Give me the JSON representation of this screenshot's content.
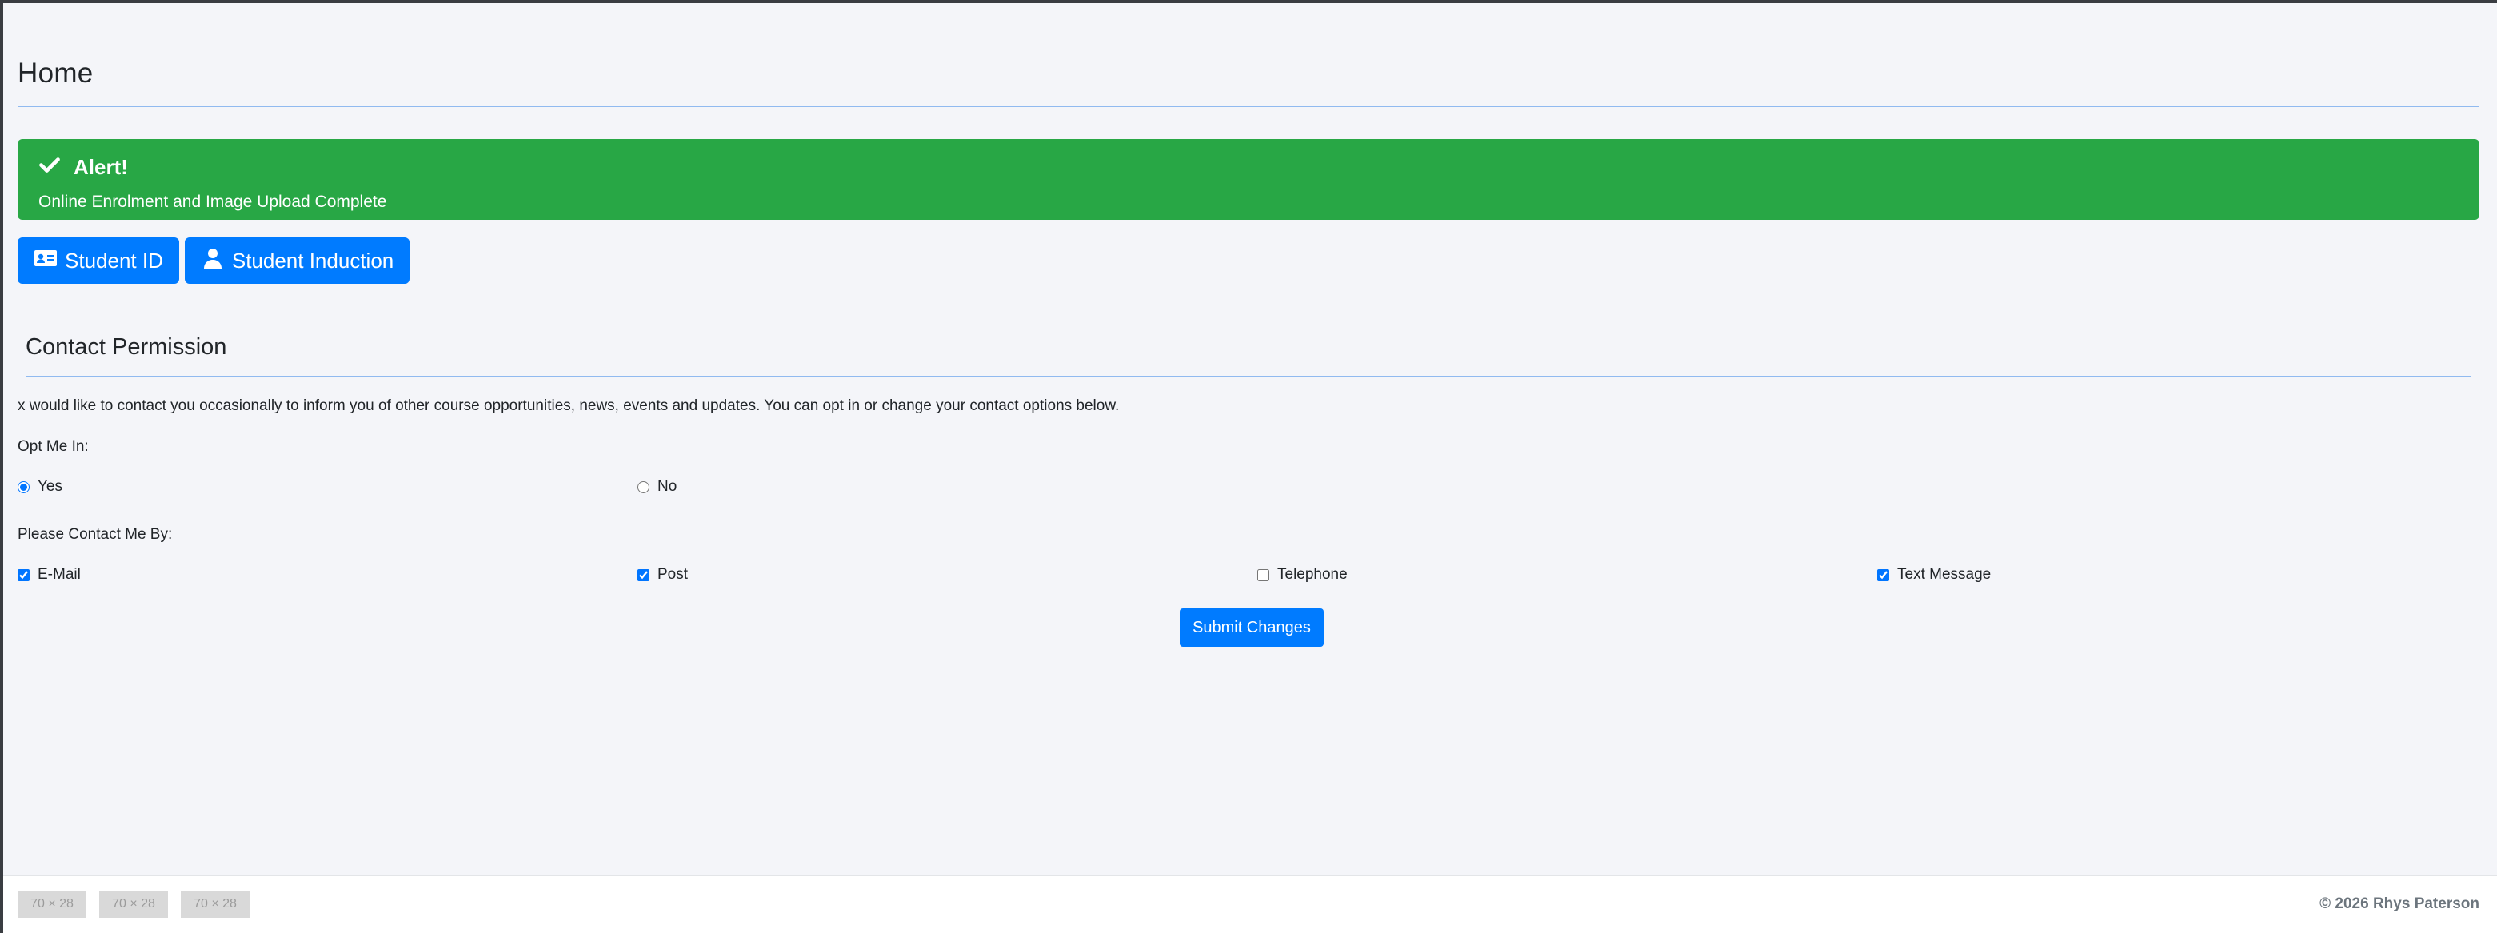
{
  "page": {
    "title": "Home"
  },
  "alert": {
    "heading": "Alert!",
    "message": "Online Enrolment and Image Upload Complete",
    "icon": "check-icon",
    "color": "#28a745"
  },
  "actions": [
    {
      "label": "Student ID",
      "icon": "id-card-icon"
    },
    {
      "label": "Student Induction",
      "icon": "user-icon"
    }
  ],
  "contact": {
    "title": "Contact Permission",
    "intro": "x would like to contact you occasionally to inform you of other course opportunities, news, events and updates. You can opt in or change your contact options below.",
    "opt_in_label": "Opt Me In:",
    "opt_in": {
      "yes": "Yes",
      "no": "No",
      "selected": "Yes"
    },
    "contact_by_label": "Please Contact Me By:",
    "methods": [
      {
        "label": "E-Mail",
        "checked": true
      },
      {
        "label": "Post",
        "checked": true
      },
      {
        "label": "Telephone",
        "checked": false
      },
      {
        "label": "Text Message",
        "checked": true
      }
    ],
    "submit_label": "Submit Changes"
  },
  "footer": {
    "placeholders": [
      "70 × 28",
      "70 × 28",
      "70 × 28"
    ],
    "copyright": "© 2026 Rhys Paterson"
  },
  "colors": {
    "primary": "#007bff",
    "success": "#28a745",
    "background": "#f4f5f9"
  }
}
